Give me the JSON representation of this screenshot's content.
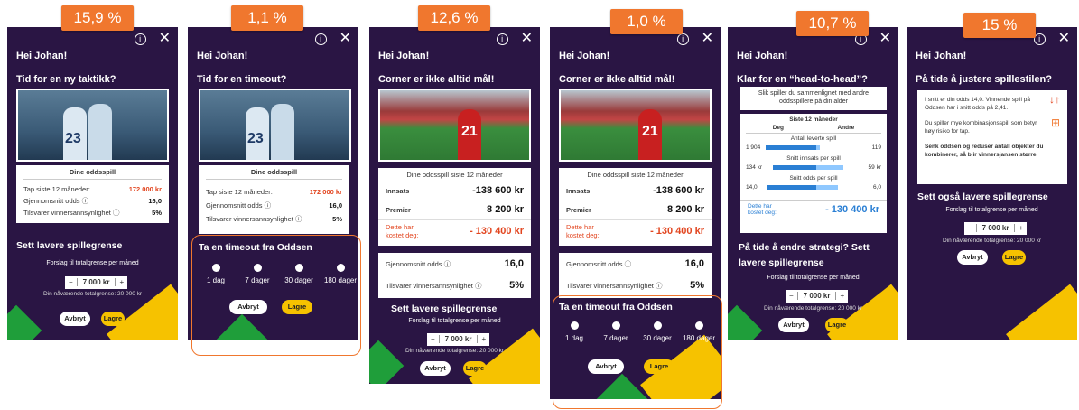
{
  "badges": [
    "15,9 %",
    "1,1 %",
    "12,6 %",
    "1,0 %",
    "10,7 %",
    "15 %"
  ],
  "common": {
    "greeting": "Hei Johan!",
    "info_glyph": "i",
    "close_glyph": "✕",
    "limit_title": "Sett lavere spillegrense",
    "limit_suggestion": "Forslag til totalgrense per måned",
    "stepper_minus": "−",
    "stepper_value": "7 000 kr",
    "stepper_plus": "+",
    "current_limit": "Din nåværende totalgrense: 20 000 kr",
    "cancel": "Avbryt",
    "save": "Lagre",
    "timeout_title": "Ta en timeout fra Oddsen",
    "timeout_options": [
      "1 dag",
      "7 dager",
      "30 dager",
      "180 dager"
    ]
  },
  "panel1": {
    "headline": "Tid for en ny taktikk?",
    "card_title": "Dine oddsspill",
    "rows": [
      {
        "label": "Tap siste 12 måneder:",
        "value": "172 000 kr"
      },
      {
        "label": "Gjennomsnitt odds",
        "value": "16,0"
      },
      {
        "label": "Tilsvarer vinnersannsynlighet",
        "value": "5%"
      }
    ],
    "jersey_number": "23"
  },
  "panel2": {
    "headline": "Tid for en timeout?",
    "card_title": "Dine oddsspill",
    "rows": [
      {
        "label": "Tap siste 12 måneder:",
        "value": "172 000 kr"
      },
      {
        "label": "Gjennomsnitt odds",
        "value": "16,0"
      },
      {
        "label": "Tilsvarer vinnersannsynlighet",
        "value": "5%"
      }
    ],
    "jersey_number": "23"
  },
  "panel3": {
    "headline": "Corner er ikke alltid mål!",
    "card_title": "Dine oddsspill siste 12 måneder",
    "rows": [
      {
        "label": "Innsats",
        "value": "-138 600 kr"
      },
      {
        "label": "Premier",
        "value": "8 200 kr"
      },
      {
        "label": "Dette har kostet deg:",
        "value": "- 130 400 kr"
      }
    ],
    "odds_label": "Gjennomsnitt odds",
    "odds_value": "16,0",
    "prob_label": "Tilsvarer vinnersannsynlighet",
    "prob_value": "5%",
    "limit_title": "Sett lavere spillegrense",
    "jersey_number": "21"
  },
  "panel4": {
    "headline": "Corner er ikke alltid mål!",
    "card_title": "Dine oddsspill siste 12 måneder",
    "rows": [
      {
        "label": "Innsats",
        "value": "-138 600 kr"
      },
      {
        "label": "Premier",
        "value": "8 200 kr"
      },
      {
        "label": "Dette har kostet deg:",
        "value": "- 130 400 kr"
      }
    ],
    "odds_label": "Gjennomsnitt odds",
    "odds_value": "16,0",
    "prob_label": "Tilsvarer vinnersannsynlighet",
    "prob_value": "5%",
    "jersey_number": "21"
  },
  "panel5": {
    "headline": "Klar for en “head-to-head”?",
    "intro": "Slik spiller du sammenlignet med andre oddsspillere på din alder",
    "period": "Siste 12 måneder",
    "col_me": "Deg",
    "col_others": "Andre",
    "metrics": [
      {
        "label": "Antall leverte spill",
        "me": "1 904",
        "others": "119"
      },
      {
        "label": "Snitt innsats per spill",
        "me": "134 kr",
        "others": "59 kr"
      },
      {
        "label": "Snitt odds per spill",
        "me": "14,0",
        "others": "6,0"
      }
    ],
    "cost_label": "Dette har kostet deg:",
    "cost_value": "- 130 400 kr",
    "strategy": "På tide å endre strategi? Sett lavere spillegrense",
    "accent": "#2a7fd4"
  },
  "panel6": {
    "headline": "På tide å justere spillestilen?",
    "p1": "I snitt er din odds 14,0. Vinnende spill på Oddsen har i snitt odds på 2,41.",
    "p2": "Du spiller mye kombinasjonsspill som betyr høy risiko for tap.",
    "p3": "Senk oddsen og reduser antall objekter du kombinerer, så blir vinnersjansen større.",
    "icon1": "↓↑",
    "icon2": "⊞",
    "limit_title": "Sett også lavere spillegrense"
  },
  "colors": {
    "panel_bg": "#2a1544",
    "badge": "#f0772e",
    "yellow": "#f6c200",
    "red": "#e2451f",
    "green": "#1f9e3a"
  }
}
